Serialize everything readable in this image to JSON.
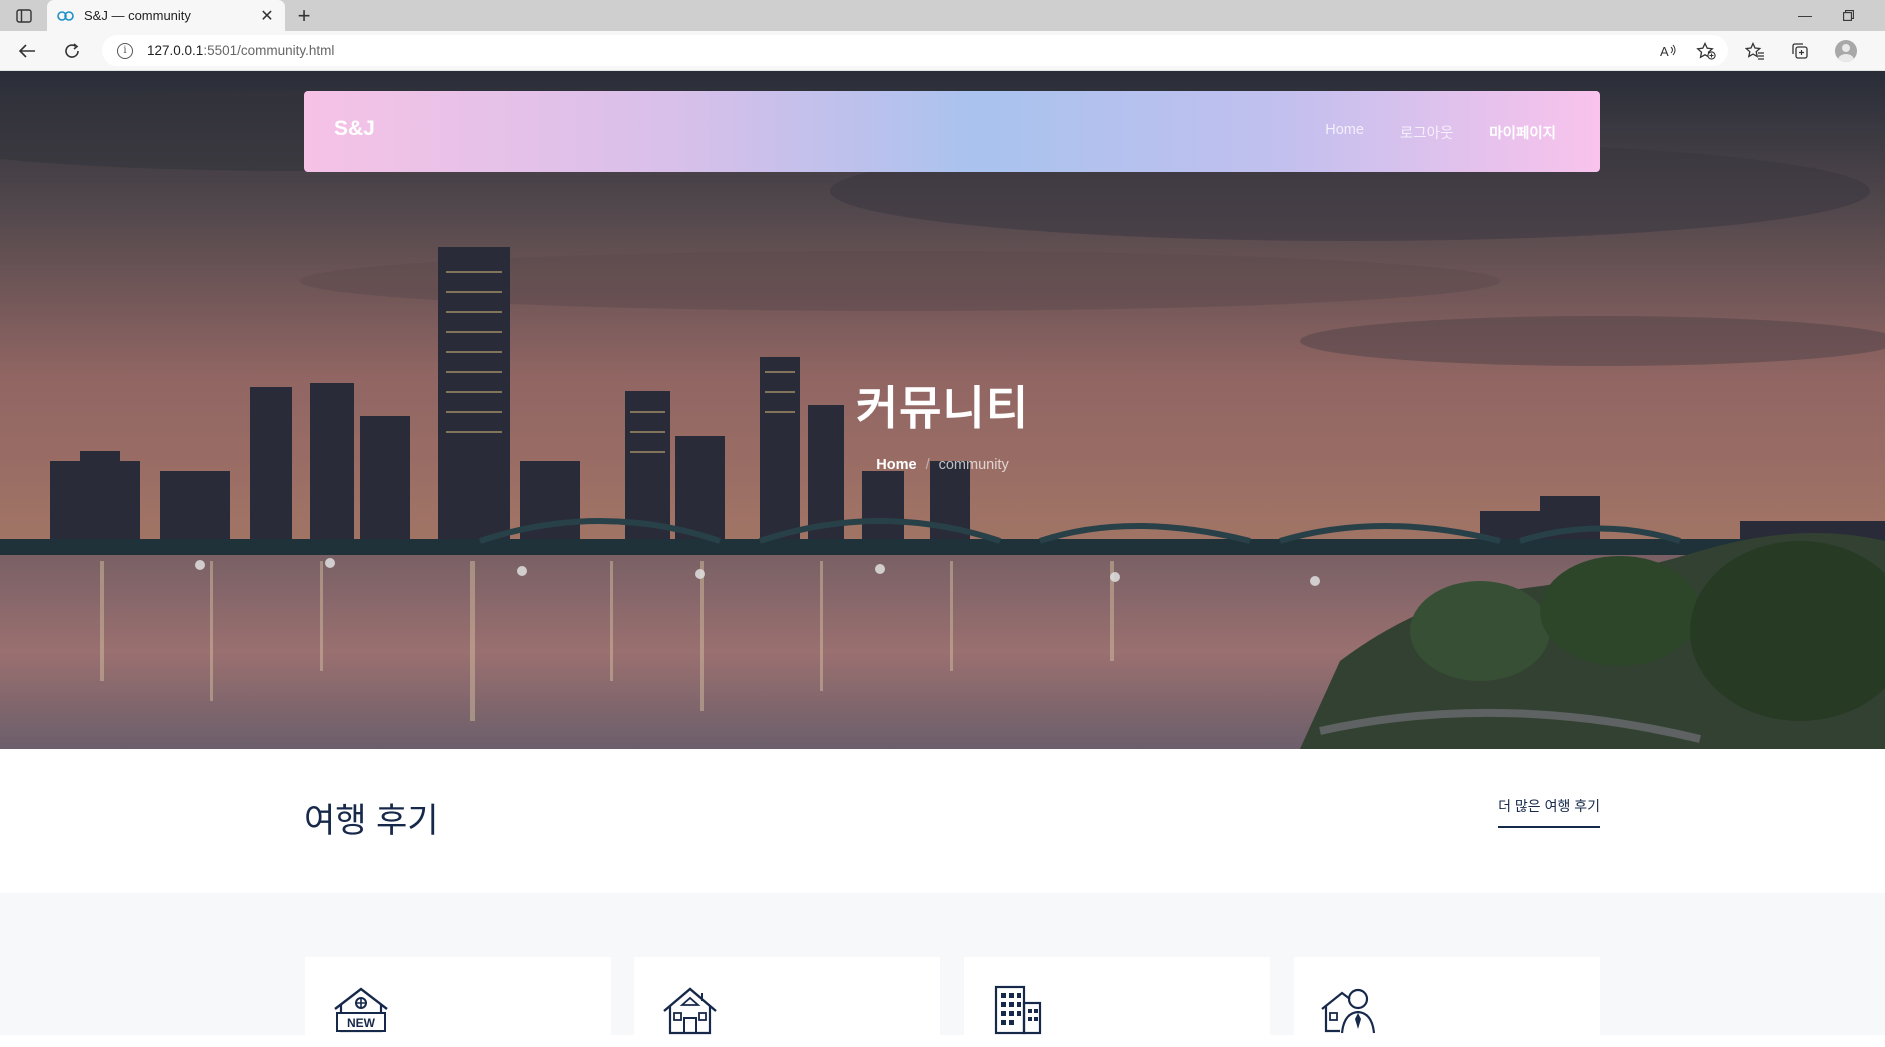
{
  "browser": {
    "tab_title": "S&J — community",
    "url_host": "127.0.0.1",
    "url_path": ":5501/community.html",
    "icons": [
      "sidebar-toggle-icon",
      "edge-favicon",
      "tab-close-icon",
      "new-tab-icon",
      "minimize-icon",
      "restore-icon",
      "back-icon",
      "reload-icon",
      "site-info-icon",
      "read-aloud-icon",
      "add-favorite-icon",
      "favorites-icon",
      "collections-icon",
      "profile-avatar"
    ]
  },
  "nav": {
    "brand": "S&J",
    "links": [
      {
        "label": "Home"
      },
      {
        "label": "로그아웃"
      },
      {
        "label": "마이페이지"
      }
    ]
  },
  "hero": {
    "title": "커뮤니티",
    "breadcrumb_home": "Home",
    "breadcrumb_sep": "/",
    "breadcrumb_current": "community"
  },
  "section": {
    "title": "여행 후기",
    "more_link": "더 많은 여행 후기"
  },
  "cards": [
    {
      "icon": "new-house-icon",
      "sign": "NEW"
    },
    {
      "icon": "house-icon"
    },
    {
      "icon": "building-icon"
    },
    {
      "icon": "agent-house-icon"
    }
  ],
  "colors": {
    "navy": "#17294a",
    "nav_gradient": [
      "#f6c2e6",
      "#a9c2ee",
      "#f9c3ec"
    ],
    "section_bg": "#f6f8fa"
  }
}
